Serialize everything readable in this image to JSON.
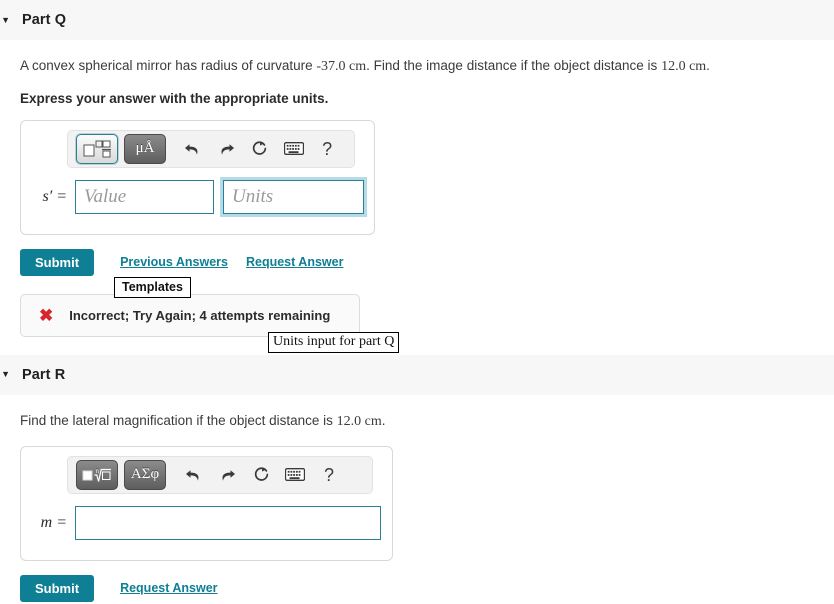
{
  "parts": [
    {
      "id": "q",
      "caret": "▼",
      "title": "Part Q",
      "question_pre": "A convex spherical mirror has radius of curvature ",
      "question_r": "-37.0 cm",
      "question_mid": ". Find the image distance if the object distance is ",
      "question_s": "12.0 cm",
      "question_post": ".",
      "instruction": "Express your answer with the appropriate units.",
      "toolbar": {
        "templates_label": "templates-icon",
        "symbols_label": "μÅ",
        "undo_label": "undo-icon",
        "redo_label": "redo-icon",
        "reset_label": "reset-icon",
        "keyboard_label": "keyboard-icon",
        "help_label": "?"
      },
      "variable_label": "s′ =",
      "value_placeholder": "Value",
      "units_placeholder": "Units",
      "value_current": "",
      "units_current": "",
      "tooltip_templates": "Templates",
      "tooltip_units": "Units input for part Q",
      "submit_label": "Submit",
      "links": [
        "Previous Answers",
        "Request Answer"
      ],
      "feedback": {
        "icon": "x-mark-icon",
        "text": "Incorrect; Try Again; 4 attempts remaining"
      }
    },
    {
      "id": "r",
      "caret": "▼",
      "title": "Part R",
      "question_pre": "Find the lateral magnification if the object distance is ",
      "question_s": "12.0 cm",
      "question_post": ".",
      "toolbar": {
        "templates_label": "root-template-icon",
        "symbols_label": "ΑΣφ",
        "undo_label": "undo-icon",
        "redo_label": "redo-icon",
        "reset_label": "reset-icon",
        "keyboard_label": "keyboard-icon",
        "help_label": "?"
      },
      "variable_label": "m =",
      "value_current": "",
      "submit_label": "Submit",
      "links": [
        "Request Answer"
      ]
    }
  ],
  "colors": {
    "accent": "#0e7f94",
    "band": "#f7f7f7",
    "error": "#d9232d",
    "input_border": "#2b7f92",
    "focus_ring": "#78bed7"
  }
}
